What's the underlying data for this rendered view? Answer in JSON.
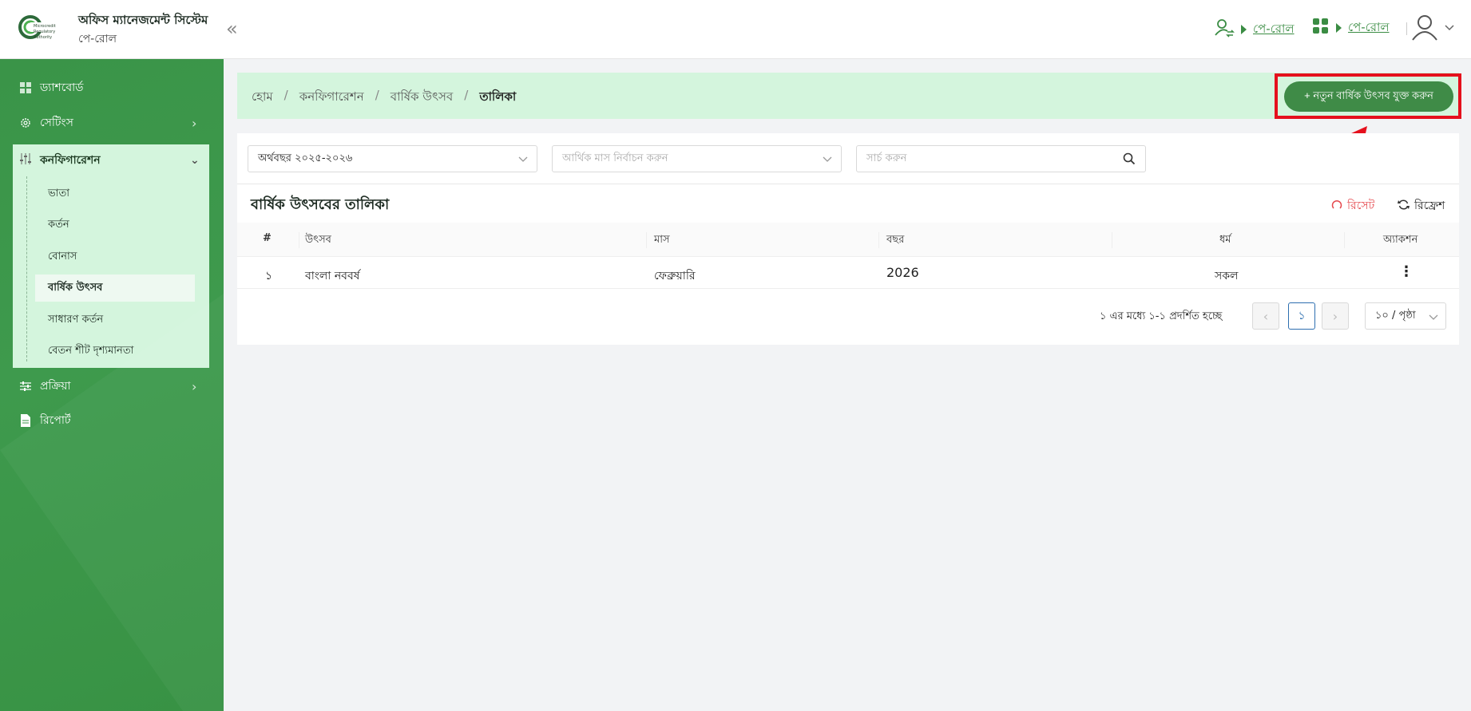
{
  "header": {
    "app_title": "অফিস ম্যানেজমেন্ট সিস্টেম",
    "app_subtitle": "পে-রোল",
    "link1_label": "পে-রোল",
    "link2_label": "পে-রোল",
    "logo_text": "Microcredit Regulatory Authority"
  },
  "sidebar": {
    "items": [
      {
        "label": "ড্যাশবোর্ড",
        "icon": "dashboard-icon"
      },
      {
        "label": "সেটিংস",
        "icon": "gear-icon"
      },
      {
        "label": "কনফিগারেশন",
        "icon": "sliders-icon"
      },
      {
        "label": "প্রক্রিয়া",
        "icon": "process-icon"
      },
      {
        "label": "রিপোর্ট",
        "icon": "document-icon"
      }
    ],
    "config_sub": [
      {
        "label": "ভাতা"
      },
      {
        "label": "কর্তন"
      },
      {
        "label": "বোনাস"
      },
      {
        "label": "বার্ষিক উৎসব"
      },
      {
        "label": "সাধারণ কর্তন"
      },
      {
        "label": "বেতন শীট দৃশ্যমানতা"
      }
    ]
  },
  "breadcrumb": {
    "items": [
      "হোম",
      "কনফিগারেশন",
      "বার্ষিক উৎসব",
      "তালিকা"
    ]
  },
  "actions": {
    "add_label": "+ নতুন বার্ষিক উৎসব যুক্ত করুন",
    "reset_label": "রিসেট",
    "refresh_label": "রিফ্রেশ"
  },
  "filters": {
    "fiscal_year_value": "অর্থবছর ২০২৫-২০২৬",
    "month_placeholder": "আর্থিক মাস নির্বাচন করুন",
    "search_placeholder": "সার্চ করুন"
  },
  "table": {
    "title": "বার্ষিক উৎসবের তালিকা",
    "columns": [
      "#",
      "উৎসব",
      "মাস",
      "বছর",
      "ধর্ম",
      "অ্যাকশন"
    ],
    "rows": [
      {
        "no": "১",
        "festival": "বাংলা নববর্ষ",
        "month": "ফেব্রুয়ারি",
        "year": "2026",
        "religion": "সকল"
      }
    ]
  },
  "pagination": {
    "info": "১ এর মধ্যে ১-১ প্রদর্শিত হচ্ছে",
    "current_page": "১",
    "page_size": "১০ / পৃষ্ঠা"
  },
  "colors": {
    "sidebar_green": "#3a9448",
    "accent_green": "#3f8b47",
    "light_green": "#d4f5dd",
    "highlight_red": "#e5101d"
  }
}
